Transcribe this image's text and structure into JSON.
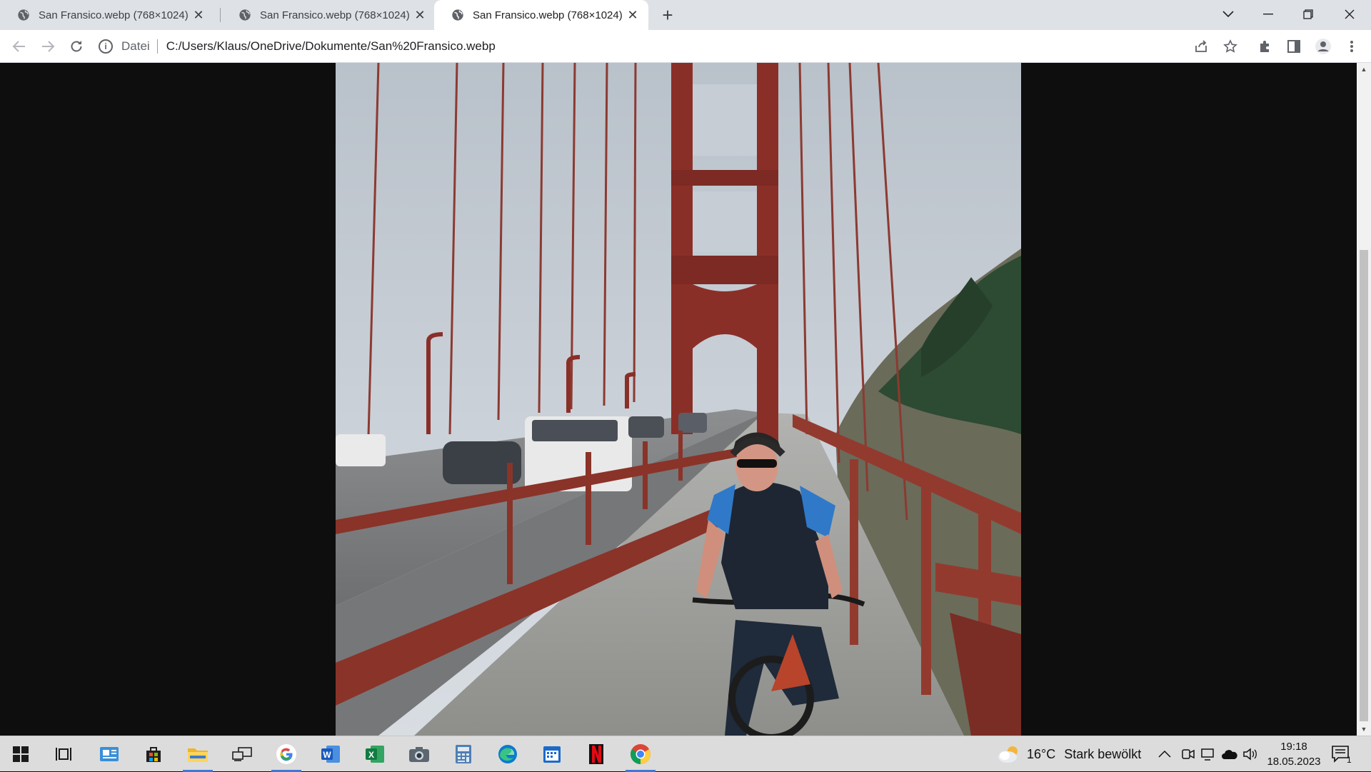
{
  "browser": {
    "tabs": [
      {
        "title": "San Fransico.webp (768×1024)",
        "active": false
      },
      {
        "title": "San Fransico.webp (768×1024)",
        "active": false
      },
      {
        "title": "San Fransico.webp (768×1024)",
        "active": true
      }
    ],
    "new_tab_label": "+",
    "omnibox": {
      "scheme_label": "Datei",
      "url": "C:/Users/Klaus/OneDrive/Dokumente/San%20Fransico.webp"
    }
  },
  "viewer": {
    "image_name": "San Fransico.webp",
    "image_dimensions": "768×1024"
  },
  "taskbar": {
    "weather": {
      "temperature": "16°C",
      "condition": "Stark bewölkt"
    },
    "clock": {
      "time": "19:18",
      "date": "18.05.2023"
    },
    "notification_count": "1",
    "apps": [
      "start",
      "task-view",
      "news",
      "store",
      "file-explorer",
      "remote-desktop",
      "google",
      "word",
      "excel",
      "camera",
      "calculator",
      "edge",
      "calendar",
      "netflix",
      "chrome"
    ]
  }
}
